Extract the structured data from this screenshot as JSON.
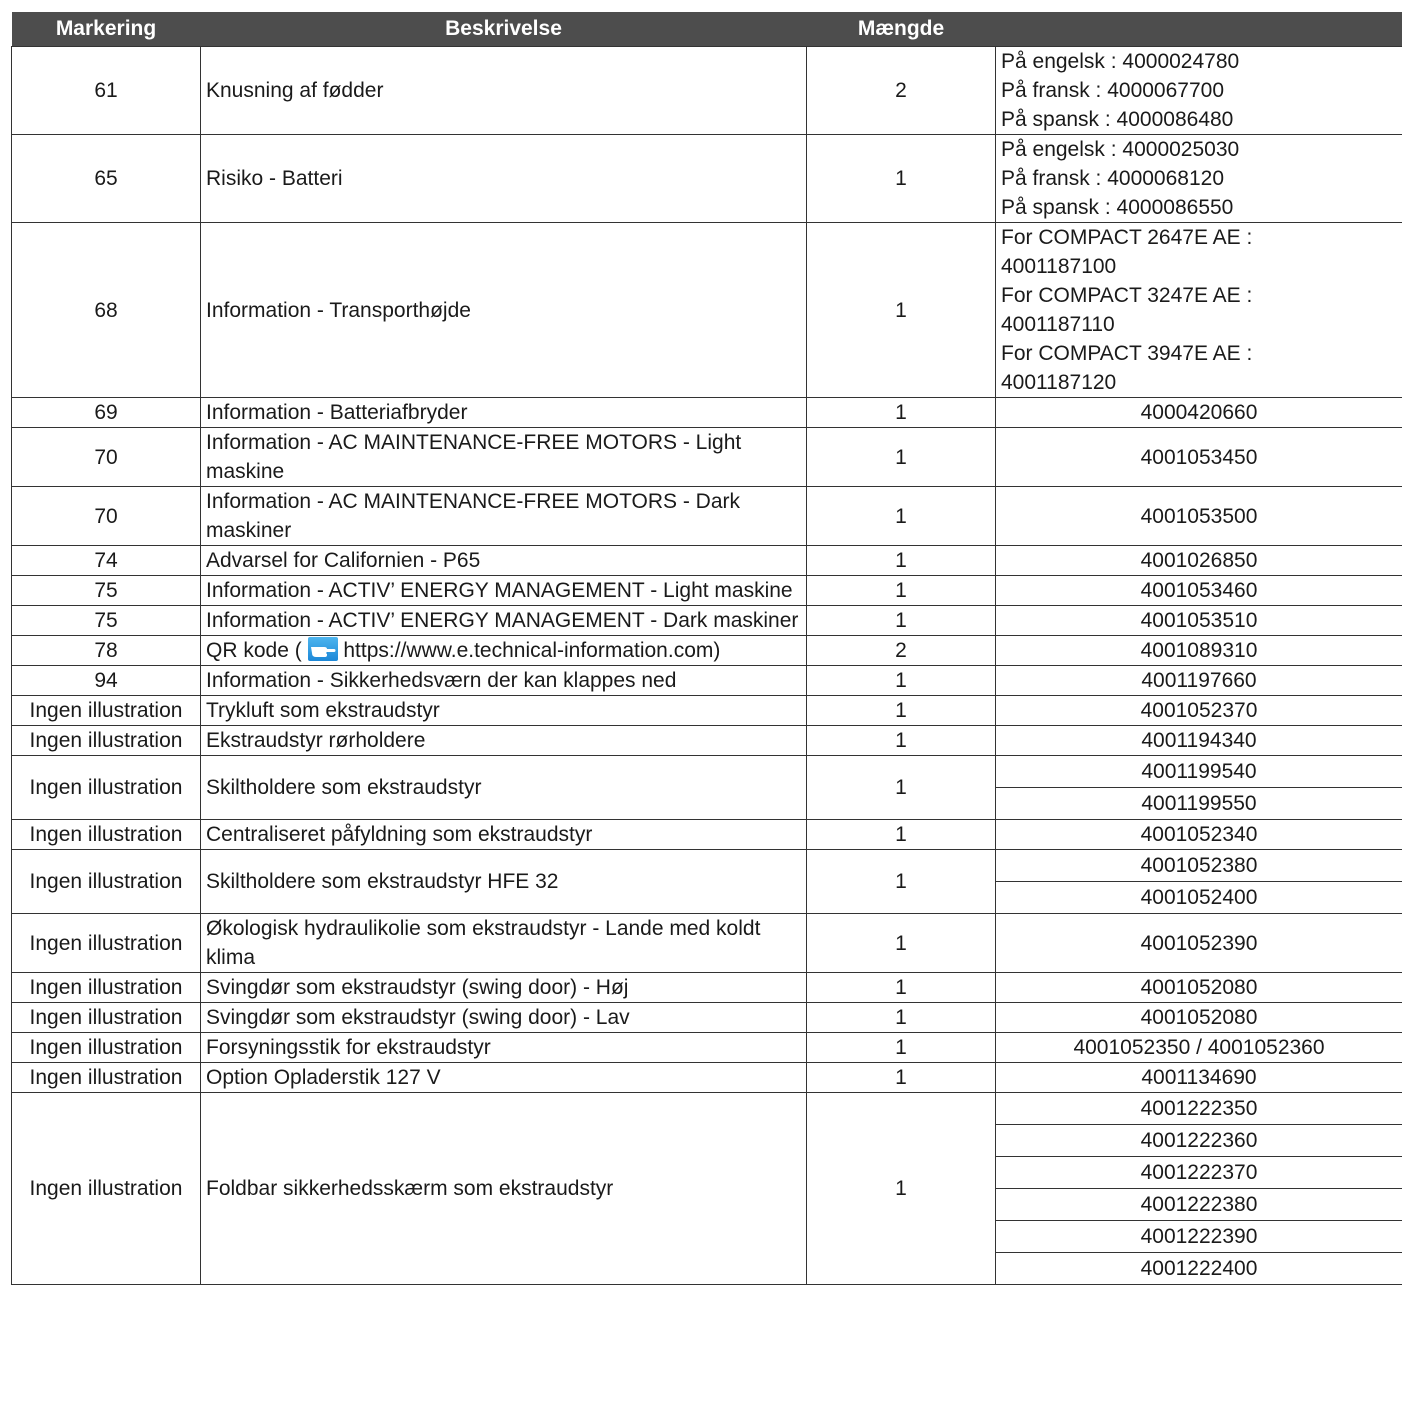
{
  "headers": {
    "markering": "Markering",
    "beskrivelse": "Beskrivelse",
    "maengde": "Mængde",
    "reference": ""
  },
  "rows": [
    {
      "mark": "61",
      "desc": "Knusning af fødder",
      "qty": "2",
      "refs": [
        "På engelsk : 4000024780",
        "På fransk : 4000067700",
        "På spansk : 4000086480"
      ]
    },
    {
      "mark": "65",
      "desc": "Risiko - Batteri",
      "qty": "1",
      "refs": [
        "På engelsk : 4000025030",
        "På fransk : 4000068120",
        "På spansk : 4000086550"
      ]
    },
    {
      "mark": "68",
      "desc": "Information - Transporthøjde",
      "qty": "1",
      "refs": [
        "For  COMPACT 2647E AE :",
        "4001187100",
        "For  COMPACT 3247E AE :",
        "4001187110",
        "For  COMPACT 3947E AE :",
        "4001187120"
      ]
    },
    {
      "mark": "69",
      "desc": "Information - Batteriafbryder",
      "qty": "1",
      "refs": [
        "4000420660"
      ]
    },
    {
      "mark": "70",
      "desc": "Information - AC MAINTENANCE-FREE MOTORS - Light maskine",
      "qty": "1",
      "refs": [
        "4001053450"
      ]
    },
    {
      "mark": "70",
      "desc": "Information - AC MAINTENANCE-FREE MOTORS - Dark maskiner",
      "qty": "1",
      "refs": [
        "4001053500"
      ]
    },
    {
      "mark": "74",
      "desc": "Advarsel for Californien - P65",
      "qty": "1",
      "refs": [
        "4001026850"
      ]
    },
    {
      "mark": "75",
      "desc": "Information - ACTIV’ ENERGY MANAGEMENT - Light maskine",
      "qty": "1",
      "refs": [
        "4001053460"
      ]
    },
    {
      "mark": "75",
      "desc": "Information - ACTIV’ ENERGY MANAGEMENT - Dark maskiner",
      "qty": "1",
      "refs": [
        "4001053510"
      ]
    },
    {
      "mark": "78",
      "desc_pre": "QR kode (",
      "desc_post": " https://www.e.technical-information.com)",
      "qty": "2",
      "refs": [
        "4001089310"
      ]
    },
    {
      "mark": "94",
      "desc": "Information - Sikkerhedsværn der kan klappes ned",
      "qty": "1",
      "refs": [
        "4001197660"
      ]
    },
    {
      "mark": "Ingen illustration",
      "desc": "Trykluft som ekstraudstyr",
      "qty": "1",
      "refs": [
        "4001052370"
      ]
    },
    {
      "mark": "Ingen illustration",
      "desc": "Ekstraudstyr rørholdere",
      "qty": "1",
      "refs": [
        "4001194340"
      ]
    },
    {
      "mark": "Ingen illustration",
      "desc": "Skiltholdere som ekstraudstyr",
      "qty": "1",
      "refs": [
        "4001199540",
        "4001199550"
      ]
    },
    {
      "mark": "Ingen illustration",
      "desc": "Centraliseret påfyldning som ekstraudstyr",
      "qty": "1",
      "refs": [
        "4001052340"
      ]
    },
    {
      "mark": "Ingen illustration",
      "desc": "Skiltholdere som ekstraudstyr HFE 32",
      "qty": "1",
      "refs": [
        "4001052380",
        "4001052400"
      ]
    },
    {
      "mark": "Ingen illustration",
      "desc": "Økologisk hydraulikolie som ekstraudstyr - Lande med koldt klima",
      "qty": "1",
      "refs": [
        "4001052390"
      ]
    },
    {
      "mark": "Ingen illustration",
      "desc": "Svingdør som ekstraudstyr (swing door) - Høj",
      "qty": "1",
      "refs": [
        "4001052080"
      ]
    },
    {
      "mark": "Ingen illustration",
      "desc": "Svingdør som ekstraudstyr (swing door) -  Lav",
      "qty": "1",
      "refs": [
        "4001052080"
      ]
    },
    {
      "mark": "Ingen illustration",
      "desc": "Forsyningsstik for ekstraudstyr",
      "qty": "1",
      "refs": [
        "4001052350 / 4001052360"
      ]
    },
    {
      "mark": "Ingen illustration",
      "desc": "Option Opladerstik  127 V",
      "qty": "1",
      "refs": [
        "4001134690"
      ]
    },
    {
      "mark": "Ingen illustration",
      "desc": "Foldbar sikkerhedsskærm som ekstraudstyr",
      "qty": "1",
      "refs": [
        "4001222350",
        "4001222360",
        "4001222370",
        "4001222380",
        "4001222390",
        "4001222400"
      ]
    }
  ]
}
